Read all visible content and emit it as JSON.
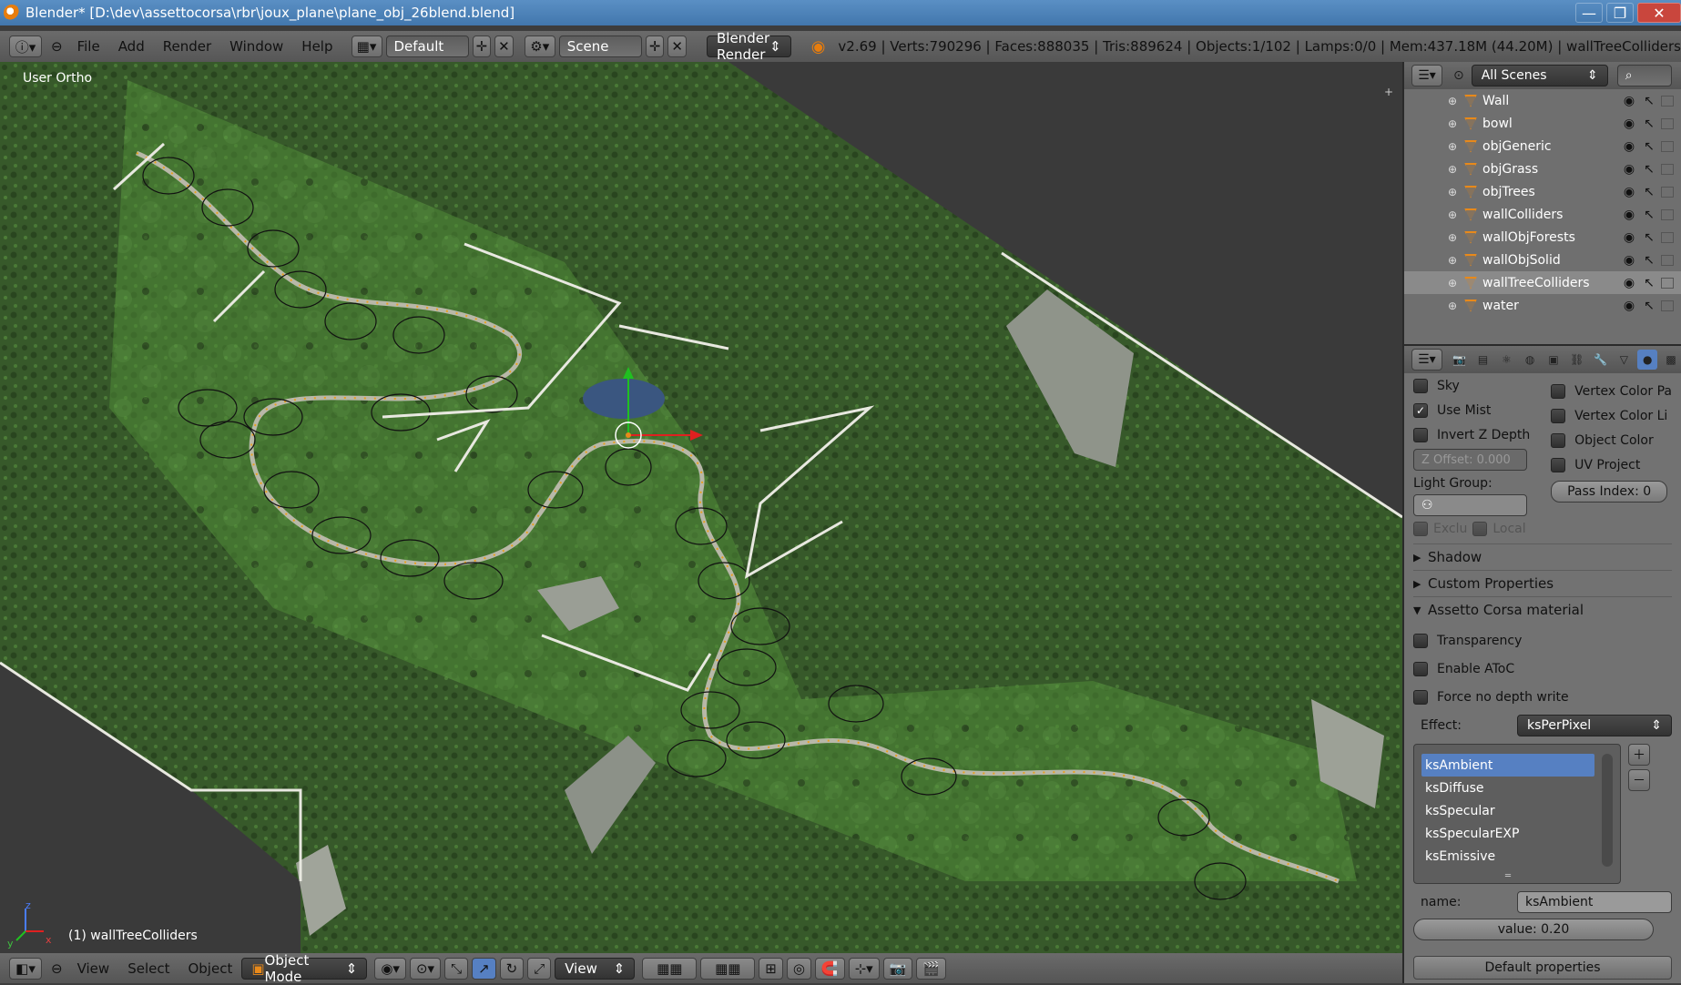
{
  "window": {
    "title": "Blender* [D:\\dev\\assettocorsa\\rbr\\joux_plane\\plane_obj_26blend.blend]",
    "minimize": "—",
    "maximize": "❐",
    "close": "✕"
  },
  "infobar": {
    "menus": [
      "File",
      "Add",
      "Render",
      "Window",
      "Help"
    ],
    "screen_layout": "Default",
    "scene": "Scene",
    "render_engine": "Blender Render",
    "stats": "v2.69 | Verts:790296 | Faces:888035 | Tris:889624 | Objects:1/102 | Lamps:0/0 | Mem:437.18M (44.20M) | wallTreeColliders"
  },
  "viewport": {
    "view_name": "User Ortho",
    "selected_object": "(1) wallTreeColliders",
    "axis_x": "x",
    "axis_y": "y",
    "axis_z": "z",
    "add_icon": "+"
  },
  "outliner": {
    "scope": "All Scenes",
    "objects": [
      {
        "name": "Wall",
        "selected": false
      },
      {
        "name": "bowl",
        "selected": false
      },
      {
        "name": "objGeneric",
        "selected": false
      },
      {
        "name": "objGrass",
        "selected": false
      },
      {
        "name": "objTrees",
        "selected": false
      },
      {
        "name": "wallColliders",
        "selected": false
      },
      {
        "name": "wallObjForests",
        "selected": false
      },
      {
        "name": "wallObjSolid",
        "selected": false
      },
      {
        "name": "wallTreeColliders",
        "selected": true
      },
      {
        "name": "water",
        "selected": false
      }
    ]
  },
  "properties": {
    "left_checks": [
      {
        "label": "Sky",
        "checked": false
      },
      {
        "label": "Use Mist",
        "checked": true
      },
      {
        "label": "Invert Z Depth",
        "checked": false
      }
    ],
    "right_checks": [
      {
        "label": "Vertex Color Pa",
        "checked": false
      },
      {
        "label": "Vertex Color Li",
        "checked": false
      },
      {
        "label": "Object Color",
        "checked": false
      },
      {
        "label": "UV Project",
        "checked": false
      }
    ],
    "z_offset": "Z Offset: 0.000",
    "light_group_label": "Light Group:",
    "pass_index": "Pass Index: 0",
    "exclude_label": "Exclu",
    "local_label": "Local",
    "panels": {
      "shadow": "Shadow",
      "custom_properties": "Custom Properties",
      "ac_material": "Assetto Corsa material"
    },
    "ac_checks": [
      {
        "label": "Transparency",
        "checked": false
      },
      {
        "label": "Enable AToC",
        "checked": false
      },
      {
        "label": "Force no depth write",
        "checked": false
      }
    ],
    "effect_label": "Effect:",
    "effect_value": "ksPerPixel",
    "shader_vars": [
      {
        "name": "ksAmbient",
        "selected": true
      },
      {
        "name": "ksDiffuse",
        "selected": false
      },
      {
        "name": "ksSpecular",
        "selected": false
      },
      {
        "name": "ksSpecularEXP",
        "selected": false
      },
      {
        "name": "ksEmissive",
        "selected": false
      }
    ],
    "name_label": "name:",
    "name_value": "ksAmbient",
    "value_field": "value: 0.20",
    "default_button": "Default properties"
  },
  "bottombar": {
    "menus": [
      "View",
      "Select",
      "Object"
    ],
    "mode": "Object Mode",
    "pivot_view": "View"
  },
  "colors": {
    "terrain_green": "#3f6b2a",
    "forest_dark": "#2c4a20",
    "road_grey": "#9a9a9a",
    "title_blue": "#4a80b8",
    "selection_blue": "#5680c2",
    "object_orange": "#e8891a"
  }
}
